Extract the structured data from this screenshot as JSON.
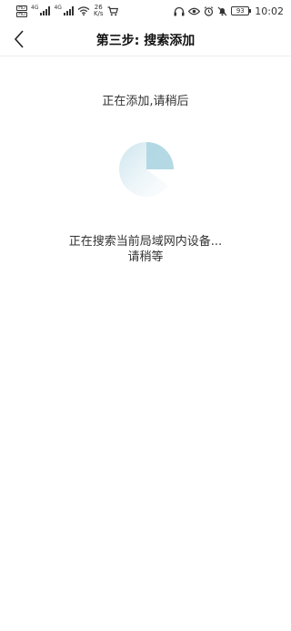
{
  "status_bar": {
    "sim1": "HD",
    "sim2": "HD",
    "net1": "4G",
    "net2": "4G",
    "speed_value": "26",
    "speed_unit": "K/s",
    "battery": "93",
    "time": "10:02"
  },
  "header": {
    "title": "第三步:  搜索添加"
  },
  "main": {
    "adding_text": "正在添加,请稍后",
    "searching_line1": "正在搜索当前局域网内设备...",
    "searching_line2": "请稍等"
  },
  "colors": {
    "spinner_accent": "#a9d3e0"
  }
}
